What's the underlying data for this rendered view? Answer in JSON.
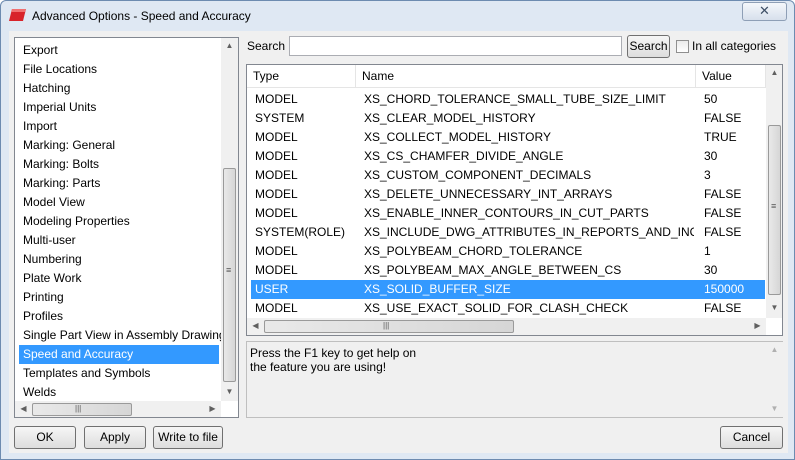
{
  "window": {
    "title": "Advanced Options - Speed and Accuracy",
    "close_glyph": "✕"
  },
  "categories": [
    "Export",
    "File Locations",
    "Hatching",
    "Imperial Units",
    "Import",
    "Marking: General",
    "Marking: Bolts",
    "Marking: Parts",
    "Model View",
    "Modeling Properties",
    "Multi-user",
    "Numbering",
    "Plate Work",
    "Printing",
    "Profiles",
    "Single Part View in Assembly Drawing",
    "Speed and Accuracy",
    "Templates and Symbols",
    "Welds"
  ],
  "selected_category": "Speed and Accuracy",
  "search": {
    "label": "Search",
    "value": "",
    "button_label": "Search",
    "all_categories_label": "In all categories",
    "all_categories_checked": false
  },
  "table": {
    "columns": [
      "Type",
      "Name",
      "Value"
    ],
    "rows": [
      {
        "type": "MODEL",
        "name": "XS_CHORD_TOLERANCE_SMALL_TUBE_SIZE_LIMIT",
        "value": "50"
      },
      {
        "type": "SYSTEM",
        "name": "XS_CLEAR_MODEL_HISTORY",
        "value": "FALSE"
      },
      {
        "type": "MODEL",
        "name": "XS_COLLECT_MODEL_HISTORY",
        "value": "TRUE"
      },
      {
        "type": "MODEL",
        "name": "XS_CS_CHAMFER_DIVIDE_ANGLE",
        "value": "30"
      },
      {
        "type": "MODEL",
        "name": "XS_CUSTOM_COMPONENT_DECIMALS",
        "value": "3"
      },
      {
        "type": "MODEL",
        "name": "XS_DELETE_UNNECESSARY_INT_ARRAYS",
        "value": "FALSE"
      },
      {
        "type": "MODEL",
        "name": "XS_ENABLE_INNER_CONTOURS_IN_CUT_PARTS",
        "value": "FALSE"
      },
      {
        "type": "SYSTEM(ROLE)",
        "name": "XS_INCLUDE_DWG_ATTRIBUTES_IN_REPORTS_AND_INQUIRE",
        "value": "FALSE"
      },
      {
        "type": "MODEL",
        "name": "XS_POLYBEAM_CHORD_TOLERANCE",
        "value": "1"
      },
      {
        "type": "MODEL",
        "name": "XS_POLYBEAM_MAX_ANGLE_BETWEEN_CS",
        "value": "30"
      },
      {
        "type": "USER",
        "name": "XS_SOLID_BUFFER_SIZE",
        "value": "150000"
      },
      {
        "type": "MODEL",
        "name": "XS_USE_EXACT_SOLID_FOR_CLASH_CHECK",
        "value": "FALSE"
      }
    ],
    "selected_row": 10
  },
  "help": {
    "line1": "Press the F1 key to get help on",
    "line2": "the feature you are using!"
  },
  "buttons": {
    "ok": "OK",
    "apply": "Apply",
    "write_to_file": "Write to file",
    "cancel": "Cancel"
  },
  "scroll_glyphs": {
    "up": "▲",
    "down": "▼",
    "left": "◀",
    "right": "▶",
    "grip_v": "≡",
    "grip_h": "|||"
  },
  "colors": {
    "selection": "#3399ff",
    "title_bar": "#dfe8f3",
    "dialog_bg": "#f0f0f0",
    "app_icon": "#d8232a"
  }
}
